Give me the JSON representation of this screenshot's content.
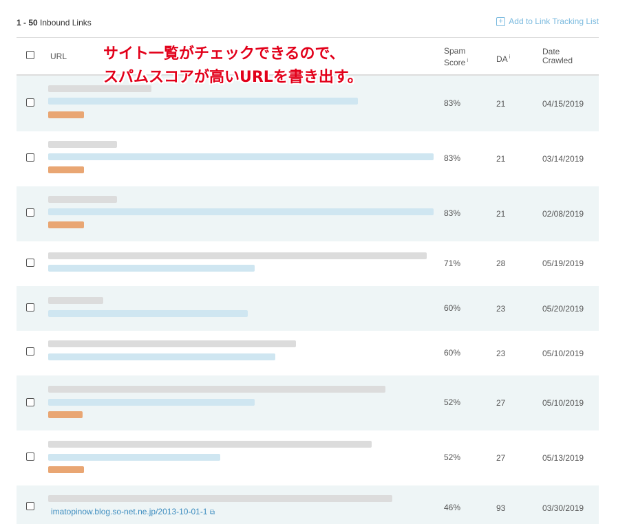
{
  "toolbar": {
    "range": "1 - 50",
    "range_label": "Inbound Links",
    "add_link_label": "Add to Link Tracking List"
  },
  "columns": {
    "url": "URL",
    "spam_line1": "Spam",
    "spam_line2": "Score",
    "da": "DA",
    "date_line1": "Date",
    "date_line2": "Crawled",
    "info_glyph": "i"
  },
  "annotation": {
    "line1": "サイト一覧がチェックできるので、",
    "line2": "スパムスコアが高いURLを書き出す。"
  },
  "rows": [
    {
      "spam": "83%",
      "da": "21",
      "date": "04/15/2019"
    },
    {
      "spam": "83%",
      "da": "21",
      "date": "03/14/2019"
    },
    {
      "spam": "83%",
      "da": "21",
      "date": "02/08/2019"
    },
    {
      "spam": "71%",
      "da": "28",
      "date": "05/19/2019"
    },
    {
      "spam": "60%",
      "da": "23",
      "date": "05/20/2019"
    },
    {
      "spam": "60%",
      "da": "23",
      "date": "05/10/2019"
    },
    {
      "spam": "52%",
      "da": "27",
      "date": "05/10/2019"
    },
    {
      "spam": "52%",
      "da": "27",
      "date": "05/13/2019"
    },
    {
      "spam": "46%",
      "da": "93",
      "date": "03/30/2019",
      "url": "imatopinow.blog.so-net.ne.jp/2013-10-01-1"
    }
  ],
  "colors": {
    "link": "#3c8cbf",
    "row_shade": "#eef5f6",
    "annotation": "#e2001a"
  }
}
